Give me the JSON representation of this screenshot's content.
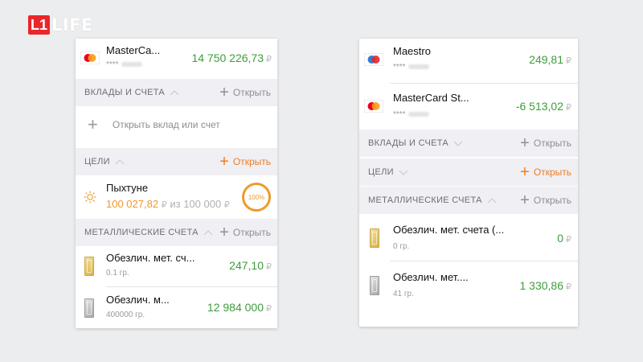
{
  "brand": {
    "logo_mark": "L1",
    "logo_text": "LIFE"
  },
  "left": {
    "card": {
      "name": "MasterCa...",
      "number": "****",
      "amount": "14 750 226,73",
      "currency": "₽"
    },
    "deposits_section": {
      "title": "ВКЛАДЫ И СЧЕТА",
      "open_label": "Открыть"
    },
    "deposits_empty": {
      "label": "Открыть вклад или счет"
    },
    "goals_section": {
      "title": "ЦЕЛИ",
      "open_label": "Открыть"
    },
    "goal": {
      "name": "Пыхтуне",
      "saved": "100 027,82",
      "currency": "₽",
      "of_label": "из",
      "target": "100 000",
      "percent_label": "100%",
      "percent_value": 100
    },
    "metals_section": {
      "title": "МЕТАЛЛИЧЕСКИЕ СЧЕТА",
      "open_label": "Открыть"
    },
    "metals": [
      {
        "name": "Обезлич. мет. сч...",
        "weight": "0.1 гр.",
        "amount": "247,10",
        "currency": "₽",
        "kind": "gold"
      },
      {
        "name": "Обезлич. м...",
        "weight": "400000 гр.",
        "amount": "12 984 000",
        "currency": "₽",
        "kind": "silver"
      }
    ]
  },
  "right": {
    "cards": [
      {
        "name": "Maestro",
        "number": "****",
        "amount": "249,81",
        "currency": "₽",
        "brand": "maestro"
      },
      {
        "name": "MasterCard St...",
        "number": "****",
        "amount": "-6 513,02",
        "currency": "₽",
        "brand": "mastercard"
      }
    ],
    "deposits_section": {
      "title": "ВКЛАДЫ И СЧЕТА",
      "open_label": "Открыть"
    },
    "goals_section": {
      "title": "ЦЕЛИ",
      "open_label": "Открыть"
    },
    "metals_section": {
      "title": "МЕТАЛЛИЧЕСКИЕ СЧЕТА",
      "open_label": "Открыть"
    },
    "metals": [
      {
        "name": "Обезлич. мет. счета (...",
        "weight": "0 гр.",
        "amount": "0",
        "currency": "₽",
        "kind": "gold"
      },
      {
        "name": "Обезлич. мет....",
        "weight": "41 гр.",
        "amount": "1 330,86",
        "currency": "₽",
        "kind": "silver"
      }
    ]
  },
  "colors": {
    "amount_green": "#3c9e3a",
    "accent_orange": "#ef7d22",
    "section_bg": "#efeff4",
    "brand_red": "#e8262b"
  }
}
